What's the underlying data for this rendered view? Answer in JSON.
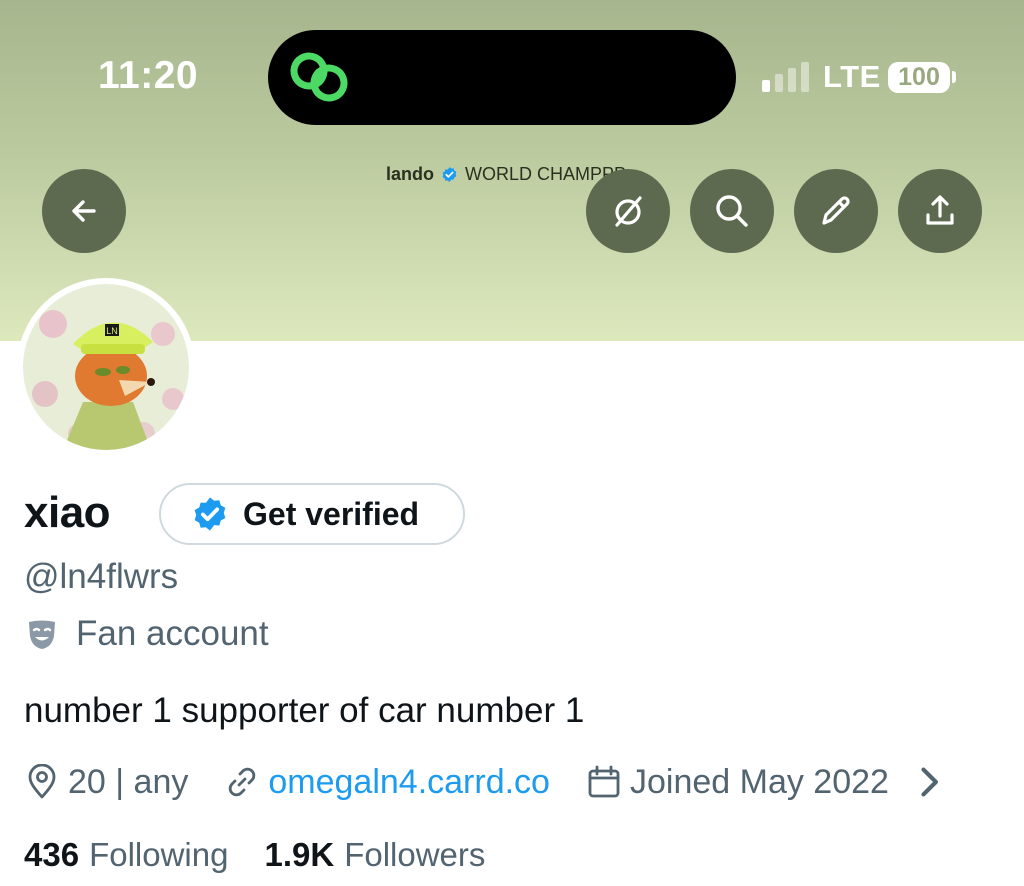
{
  "status_bar": {
    "time": "11:20",
    "network": "LTE",
    "battery": "100",
    "dynamic_island_icon": "link-rings-icon",
    "accent": "#4cd964"
  },
  "header": {
    "mini_name": "lando",
    "mini_subtitle": "WORLD CHAMPPP",
    "buttons": [
      "back-arrow-icon",
      "grok-icon",
      "search-icon",
      "edit-pencil-icon",
      "share-icon"
    ]
  },
  "profile": {
    "display_name": "xiao",
    "get_verified_label": "Get verified",
    "handle": "@ln4flwrs",
    "label": "Fan account",
    "bio": "number 1 supporter of car number 1",
    "location": "20 | any",
    "website": "omegaln4.carrd.co",
    "joined": "Joined May 2022",
    "following_count": "436",
    "following_label": "Following",
    "followers_count": "1.9K",
    "followers_label": "Followers",
    "avatar_badge": "LN",
    "link_color": "#1d9bf0",
    "verified_color": "#1d9bf0"
  }
}
